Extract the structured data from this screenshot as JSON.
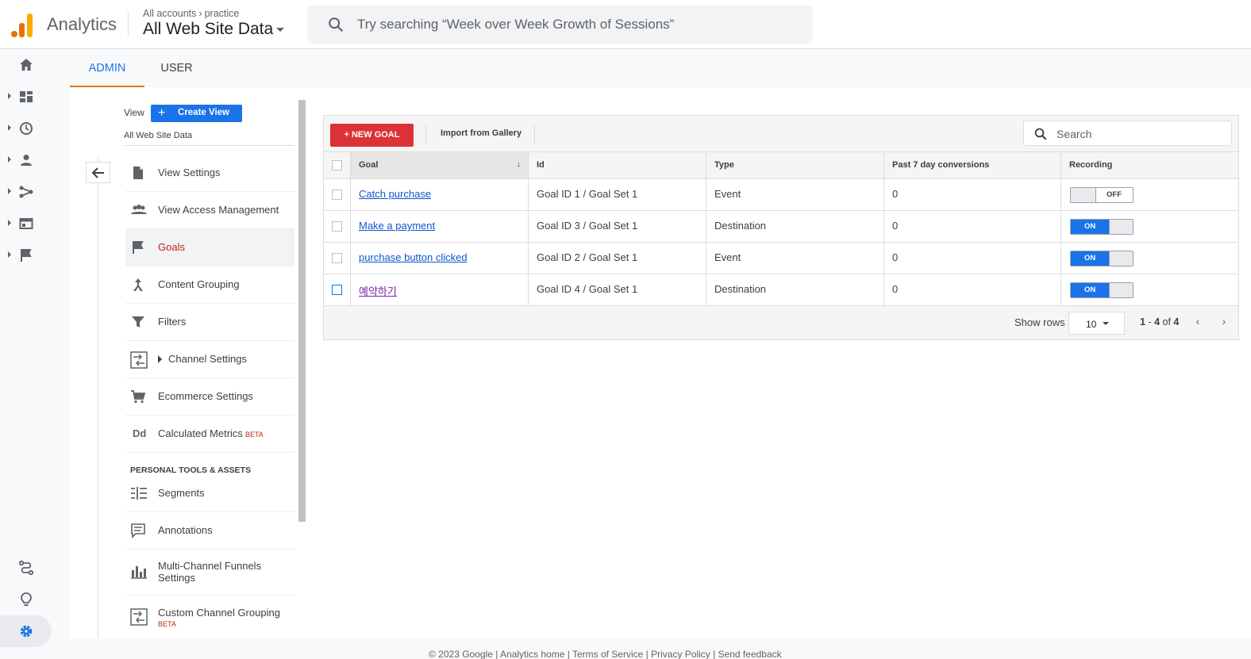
{
  "app": {
    "name": "Analytics",
    "breadcrumb": [
      "All accounts",
      "practice"
    ],
    "property": "All Web Site Data",
    "search_placeholder": "Try searching “Week over Week Growth of Sessions”"
  },
  "tabs": [
    {
      "label": "ADMIN",
      "active": true
    },
    {
      "label": "USER",
      "active": false
    }
  ],
  "view": {
    "label": "View",
    "create_label": "Create View",
    "name": "All Web Site Data"
  },
  "menu": {
    "items": [
      {
        "label": "View Settings",
        "icon": "document-icon"
      },
      {
        "label": "View Access Management",
        "icon": "people-icon"
      },
      {
        "label": "Goals",
        "icon": "flag-icon",
        "active": true
      },
      {
        "label": "Content Grouping",
        "icon": "content-grouping-icon"
      },
      {
        "label": "Filters",
        "icon": "filter-icon"
      },
      {
        "label": "Channel Settings",
        "icon": "channel-icon",
        "expandable": true
      },
      {
        "label": "Ecommerce Settings",
        "icon": "cart-icon"
      },
      {
        "label": "Calculated Metrics",
        "icon": "dd-icon",
        "badge": "BETA"
      }
    ],
    "section_title": "PERSONAL TOOLS & ASSETS",
    "personal_items": [
      {
        "label": "Segments",
        "icon": "segments-icon"
      },
      {
        "label": "Annotations",
        "icon": "annotations-icon"
      },
      {
        "label": "Multi-Channel Funnels",
        "label2": "Settings",
        "icon": "funnel-icon"
      },
      {
        "label": "Custom Channel Grouping",
        "label2": "BETA",
        "icon": "channel-icon"
      }
    ],
    "dd_text": "Dd"
  },
  "goals": {
    "new_goal_label": "+ NEW GOAL",
    "import_label": "Import from Gallery",
    "search_placeholder": "Search",
    "columns": [
      "Goal",
      "Id",
      "Type",
      "Past 7 day conversions",
      "Recording"
    ],
    "sort_indicator": "↓",
    "rows": [
      {
        "goal": "Catch purchase",
        "id": "Goal ID 1 / Goal Set 1",
        "type": "Event",
        "conversions": "0",
        "recording": "OFF"
      },
      {
        "goal": "Make a payment",
        "id": "Goal ID 3 / Goal Set 1",
        "type": "Destination",
        "conversions": "0",
        "recording": "ON"
      },
      {
        "goal": "purchase button clicked",
        "id": "Goal ID 2 / Goal Set 1",
        "type": "Event",
        "conversions": "0",
        "recording": "ON"
      },
      {
        "goal": "예약하기",
        "id": "Goal ID 4 / Goal Set 1",
        "type": "Destination",
        "conversions": "0",
        "recording": "ON"
      }
    ],
    "show_rows_label": "Show rows",
    "rows_per_page": "10",
    "pager": {
      "start": "1",
      "end": "4",
      "of": "of",
      "total": "4"
    }
  },
  "footer": {
    "text": "© 2023 Google | Analytics home | Terms of Service | Privacy Policy | Send feedback"
  },
  "colors": {
    "accent": "#1a73e8",
    "new_goal": "#db3236",
    "active_menu": "#c5221f",
    "tab_underline": "#e37400"
  }
}
